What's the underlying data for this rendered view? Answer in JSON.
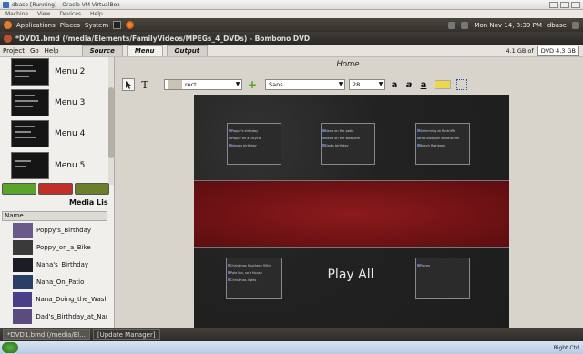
{
  "vbox": {
    "title": "dbase [Running] - Oracle VM VirtualBox",
    "menu": [
      "Machine",
      "View",
      "Devices",
      "Help"
    ]
  },
  "panel": {
    "menus": [
      "Applications",
      "Places",
      "System"
    ],
    "clock": "Mon Nov 14,  8:39 PM",
    "user": "dbase"
  },
  "app": {
    "title": "*DVD1.bmd (/media/Elements/FamilyVideos/MPEGs_4_DVDs) - Bombono DVD",
    "menus": [
      "Project",
      "Go",
      "Help"
    ],
    "tabs": [
      "Source",
      "Menu",
      "Output"
    ],
    "active_tab": "Menu",
    "capacity": "4.1 GB of",
    "disc": "DVD 4.3 GB"
  },
  "left": {
    "menus": [
      "Menu 2",
      "Menu 3",
      "Menu 4",
      "Menu 5"
    ],
    "media_title": "Media Lis",
    "media_header": "Name",
    "media": [
      "Poppy's_Birthday",
      "Poppy_on_a_Bike",
      "Nana's_Birthday",
      "Nana_On_Patio",
      "Nana_Doing_the_Washi",
      "Dad's_Birthday_at_Nan"
    ]
  },
  "editor": {
    "heading": "Home",
    "frame_style": "rect",
    "font": "Sans",
    "size": "28",
    "play_all": "Play All",
    "buttons": [
      [
        "Poppy's birthday",
        "Poppy on a bicycle",
        "Nana's birthday"
      ],
      [
        "Nana on the patio",
        "Nana on the washline",
        "Dad's birthday"
      ],
      [
        "Swimming at Redcliffe",
        "Hot-swapper at Redcliffe",
        "Beach Rainbow"
      ],
      [
        "Christmas Southern 95th",
        "Pole Inn, so's House",
        "Christmas lights"
      ],
      [
        "Pieces"
      ]
    ]
  },
  "taskbar": {
    "tasks": [
      "*DVD1.bmd (/media/El...",
      "[Update Manager]"
    ],
    "host_tray": "Right Ctrl"
  },
  "colors": {
    "accent_yellow": "#f2d64a",
    "band_red": "#7a1416",
    "add_green": "#5aa42a",
    "remove_red": "#c03028"
  }
}
